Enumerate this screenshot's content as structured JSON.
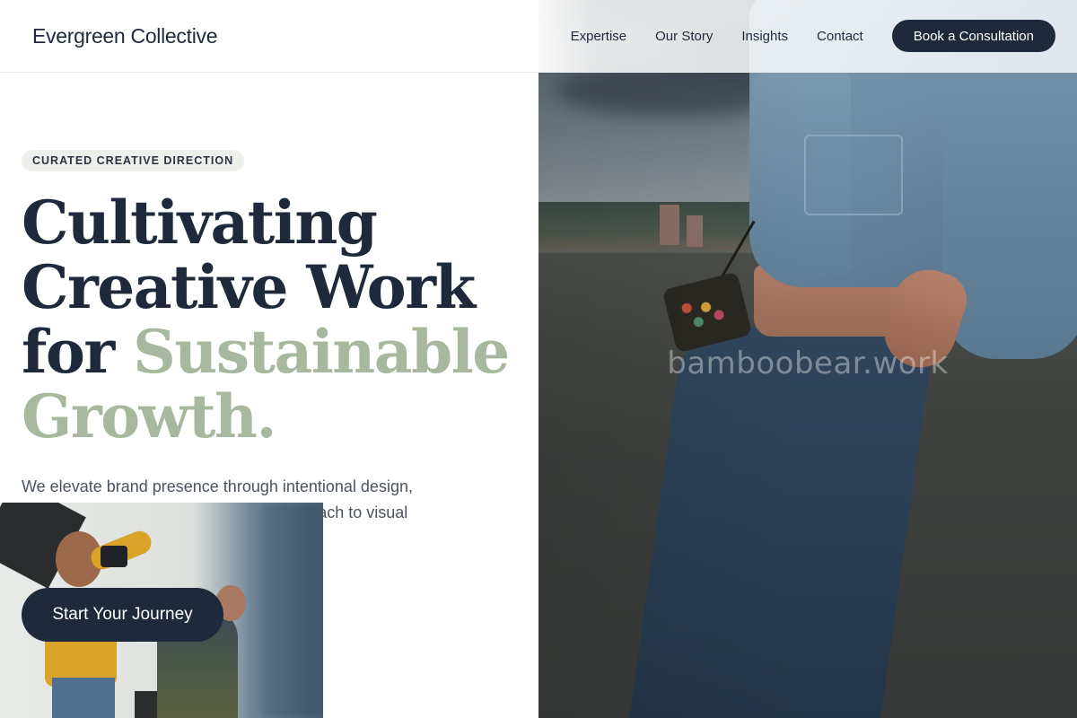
{
  "header": {
    "brand": "Evergreen Collective",
    "nav": [
      {
        "label": "Expertise"
      },
      {
        "label": "Our Story"
      },
      {
        "label": "Insights"
      },
      {
        "label": "Contact"
      }
    ],
    "cta_label": "Book a Consultation"
  },
  "hero": {
    "eyebrow": "CURATED CREATIVE DIRECTION",
    "headline_line1": "Cultivating",
    "headline_line2": "Creative Work",
    "headline_line3_prefix": "for ",
    "headline_accent_1": "Sustainable",
    "headline_accent_2": "Growth.",
    "subtext": "We elevate brand presence through intentional design, strategic storytelling, and a curated approach to visual identity.",
    "cta_label": "Start Your Journey",
    "watermark": "bamboobear.work"
  },
  "colors": {
    "navy": "#1e2a3b",
    "sage_accent": "#a7b89e",
    "eyebrow_bg": "#eef0ec"
  }
}
